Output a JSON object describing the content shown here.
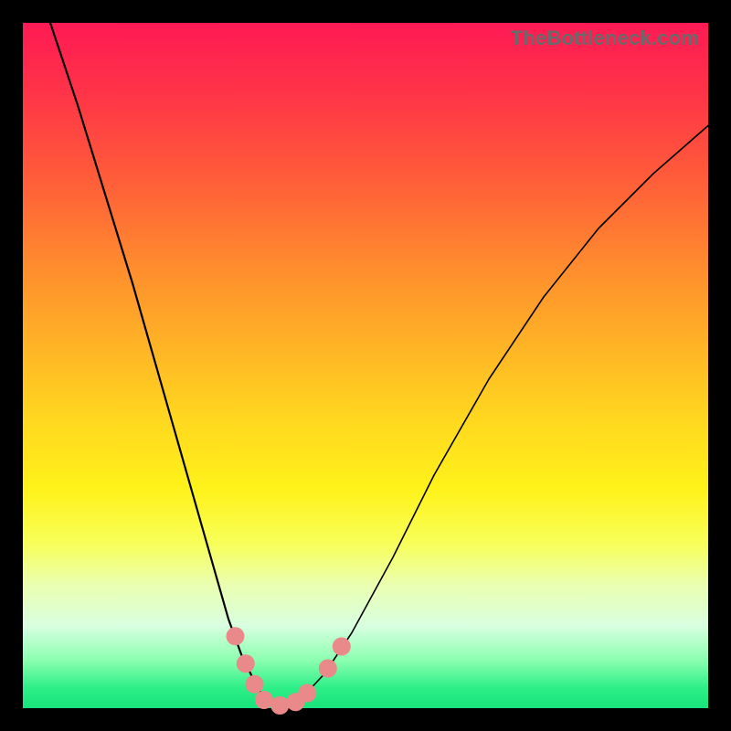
{
  "watermark": "TheBottleneck.com",
  "colors": {
    "dot": "#e98989",
    "curve": "#000000"
  },
  "chart_data": {
    "type": "line",
    "title": "",
    "xlabel": "",
    "ylabel": "",
    "xlim": [
      0,
      100
    ],
    "ylim": [
      0,
      100
    ],
    "grid": false,
    "series": [
      {
        "name": "bottleneck-curve",
        "x": [
          4,
          8,
          12,
          16,
          20,
          24,
          28,
          30,
          32,
          34,
          35,
          36,
          37.5,
          39,
          41,
          44,
          48,
          54,
          60,
          68,
          76,
          84,
          92,
          100
        ],
        "y": [
          100,
          88,
          75,
          62,
          48,
          34,
          20,
          13,
          7.5,
          3.5,
          1.8,
          0.7,
          0.2,
          0.5,
          1.8,
          5,
          11,
          22,
          34,
          48,
          60,
          70,
          78,
          85
        ]
      }
    ],
    "markers": [
      {
        "x": 31.0,
        "y": 10.5
      },
      {
        "x": 32.5,
        "y": 6.5
      },
      {
        "x": 33.8,
        "y": 3.5
      },
      {
        "x": 35.2,
        "y": 1.2
      },
      {
        "x": 37.5,
        "y": 0.4
      },
      {
        "x": 39.8,
        "y": 0.9
      },
      {
        "x": 41.5,
        "y": 2.2
      },
      {
        "x": 44.5,
        "y": 5.8
      },
      {
        "x": 46.5,
        "y": 9.0
      }
    ]
  }
}
